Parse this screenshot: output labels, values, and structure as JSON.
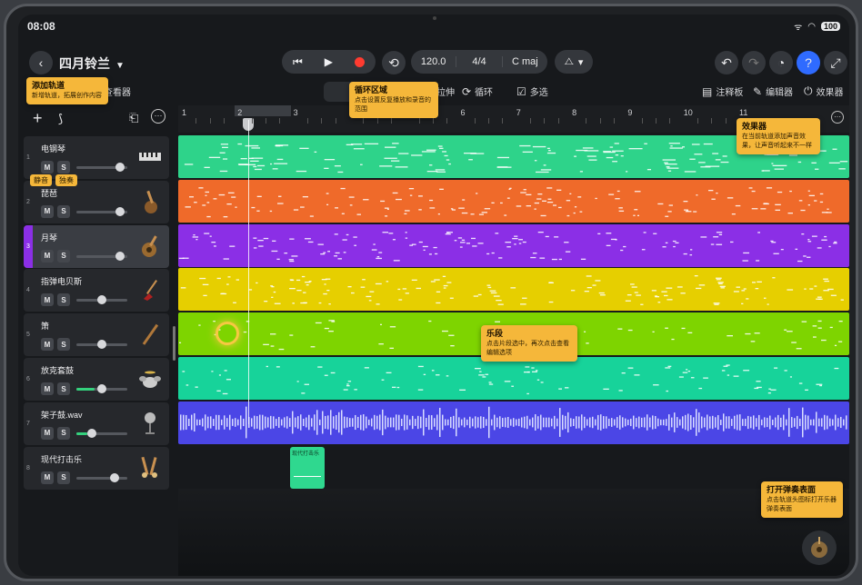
{
  "status": {
    "time": "08:08",
    "battery": "100"
  },
  "project": {
    "title": "四月铃兰"
  },
  "tempo": {
    "bpm": "120.0",
    "signature": "4/4",
    "key": "C maj"
  },
  "toolbar": {
    "view_label": "查看器",
    "stretch_label": "拉伸",
    "loop_label": "循环",
    "multiselect_label": "多选",
    "notes_label": "注释板",
    "editor_label": "编辑器",
    "effects_label": "效果器"
  },
  "ruler": {
    "bars": [
      "1",
      "2",
      "3",
      "4",
      "5",
      "6",
      "7",
      "8",
      "9",
      "10",
      "11"
    ]
  },
  "tracks": [
    {
      "num": "1",
      "name": "电钢琴",
      "volume": 0.85,
      "color": "#2ed38a"
    },
    {
      "num": "2",
      "name": "琵琶",
      "volume": 0.85,
      "color": "#ef6a2a"
    },
    {
      "num": "3",
      "name": "月琴",
      "volume": 0.85,
      "color": "#8b2fe6"
    },
    {
      "num": "4",
      "name": "指弹电贝斯",
      "volume": 0.5,
      "color": "#e6cf00"
    },
    {
      "num": "5",
      "name": "箫",
      "volume": 0.5,
      "color": "#7ed400"
    },
    {
      "num": "6",
      "name": "放克套鼓",
      "volume": 0.5,
      "color": "#17d39a"
    },
    {
      "num": "7",
      "name": "架子鼓.wav",
      "volume": 0.3,
      "color": "#4b46e6"
    },
    {
      "num": "8",
      "name": "现代打击乐",
      "volume": 0.75,
      "color": "#2ed38a"
    }
  ],
  "buttons": {
    "mute": "M",
    "solo": "S"
  },
  "clip": {
    "label": "现代打击乐"
  },
  "tips": {
    "add_track_title": "添加轨道",
    "add_track_body": "新增轨道，拓展创作内容",
    "mute": "静音",
    "solo": "独奏",
    "loop_title": "循环区域",
    "loop_body": "点击设置反复播放和录音的范围",
    "effects_title": "效果器",
    "effects_body": "在当前轨道添加声音效果，让声音听起来不一样",
    "region_title": "乐段",
    "region_body": "点击片段选中，再次点击查看编辑选项",
    "play_title": "打开弹奏表面",
    "play_body": "点击轨道头图标打开乐器弹奏表面"
  }
}
